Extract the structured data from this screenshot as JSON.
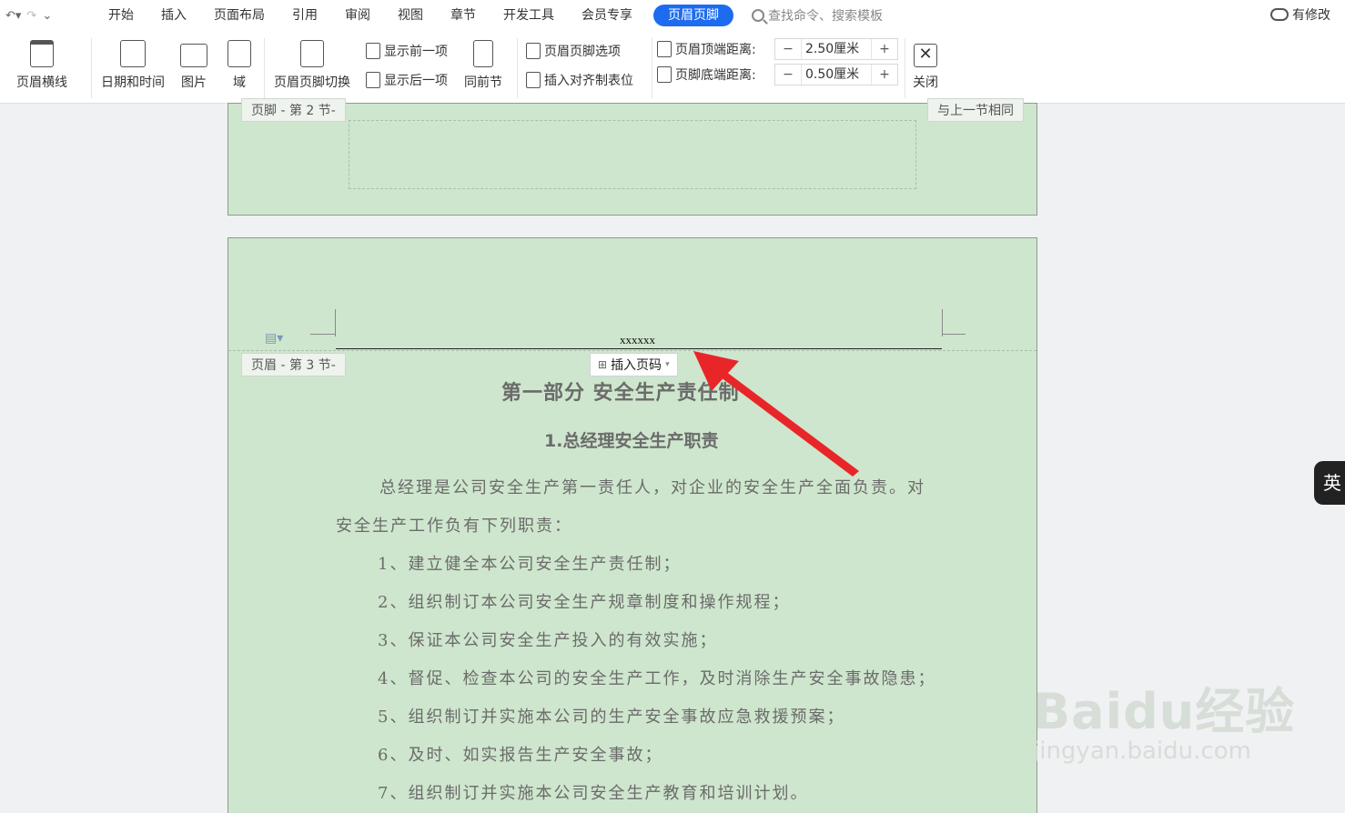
{
  "quick_access": {
    "undo_icon": "undo-icon",
    "redo_icon": "redo-icon",
    "more_icon": "chevron-down-icon"
  },
  "menu": {
    "tabs": [
      "开始",
      "插入",
      "页面布局",
      "引用",
      "审阅",
      "视图",
      "章节",
      "开发工具",
      "会员专享"
    ],
    "active_tab": "页眉页脚",
    "search_placeholder": "查找命令、搜索模板",
    "modify_label": "有修改"
  },
  "ribbon": {
    "header_line": "页眉横线",
    "date_time": "日期和时间",
    "picture": "图片",
    "field": "域",
    "switch": "页眉页脚切换",
    "show_prev": "显示前一项",
    "show_next": "显示后一项",
    "same_as_prev": "同前节",
    "options": "页眉页脚选项",
    "align_tab": "插入对齐制表位",
    "header_top_label": "页眉顶端距离:",
    "header_top_value": "2.50厘米",
    "footer_bottom_label": "页脚底端距离:",
    "footer_bottom_value": "0.50厘米",
    "minus": "−",
    "plus": "+",
    "close": "关闭"
  },
  "page1": {
    "footer_tag": "页脚  - 第 2 节-",
    "same_tag": "与上一节相同"
  },
  "page2": {
    "header_text": "xxxxxx",
    "header_tag": "页眉  - 第 3 节-",
    "insert_page_number": "插入页码",
    "title1": "第一部分      安全生产责任制",
    "title2": "1.总经理安全生产职责",
    "para1_line1": "总经理是公司安全生产第一责任人，对企业的安全生产全面负责。对",
    "para1_line2": "安全生产工作负有下列职责：",
    "items": [
      "1、建立健全本公司安全生产责任制；",
      "2、组织制订本公司安全生产规章制度和操作规程；",
      "3、保证本公司安全生产投入的有效实施；",
      "4、督促、检查本公司的安全生产工作，及时消除生产安全事故隐患；",
      "5、组织制订并实施本公司的生产安全事故应急救援预案；",
      "6、及时、如实报告生产安全事故；",
      "7、组织制订并实施本公司安全生产教育和培训计划。"
    ]
  },
  "ime_indicator": "英",
  "watermark": {
    "line1": "Baidu经验",
    "line2": "jingyan.baidu.com"
  },
  "colors": {
    "accent": "#1d6cf0",
    "page_bg": "#cee6cd",
    "arrow": "#e8262a"
  }
}
